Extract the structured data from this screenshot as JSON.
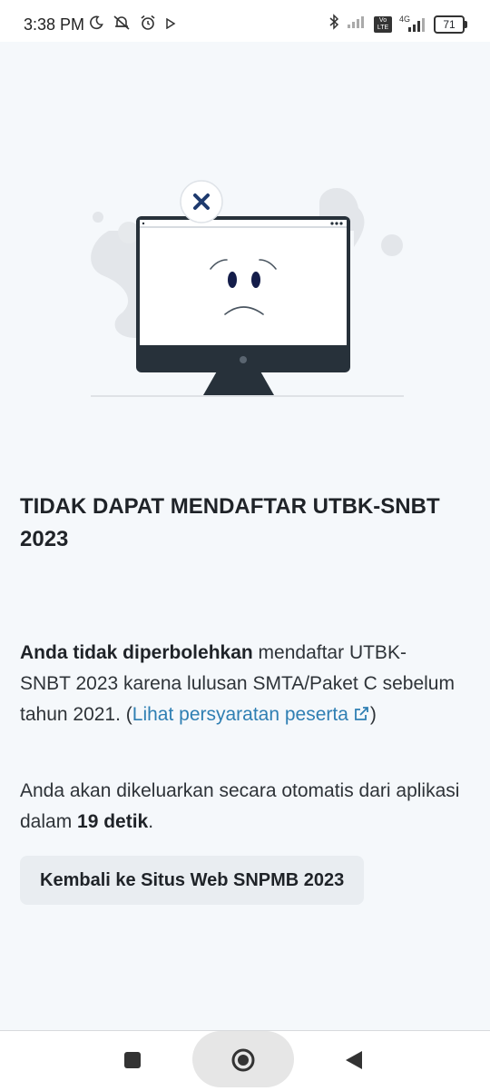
{
  "status_bar": {
    "time": "3:38 PM",
    "left_icons": [
      "moon-icon",
      "bell-off-icon",
      "alarm-icon",
      "play-icon"
    ],
    "right_icons": [
      "bluetooth-icon",
      "signal-icon",
      "volte-icon",
      "4g-icon"
    ],
    "battery": "71",
    "volte_label": "Vo LTE",
    "network_label": "4G"
  },
  "error": {
    "illustration": "sad-computer-error-illustration",
    "title": "TIDAK DAPAT MENDAFTAR UTBK-SNBT 2023",
    "para1_bold": "Anda tidak diperbolehkan",
    "para1_text": " mendaftar UTBK-SNBT 2023 karena lulusan SMTA/Paket C sebelum tahun 2021. (",
    "para1_link": "Lihat persyaratan peserta",
    "para1_close": ")",
    "para2_text": "Anda akan dikeluarkan secara otomatis dari aplikasi dalam ",
    "para2_bold": "19 detik",
    "para2_end": ".",
    "button_label": "Kembali ke Situs Web SNPMB 2023"
  },
  "colors": {
    "background": "#f5f8fb",
    "link": "#2f7fb3",
    "button_bg": "#e9edf1",
    "monitor": "#27313a",
    "x_mark": "#1e3a6e"
  },
  "nav_bar": {
    "buttons": [
      "recents-square-icon",
      "home-circle-icon",
      "back-triangle-icon"
    ]
  }
}
